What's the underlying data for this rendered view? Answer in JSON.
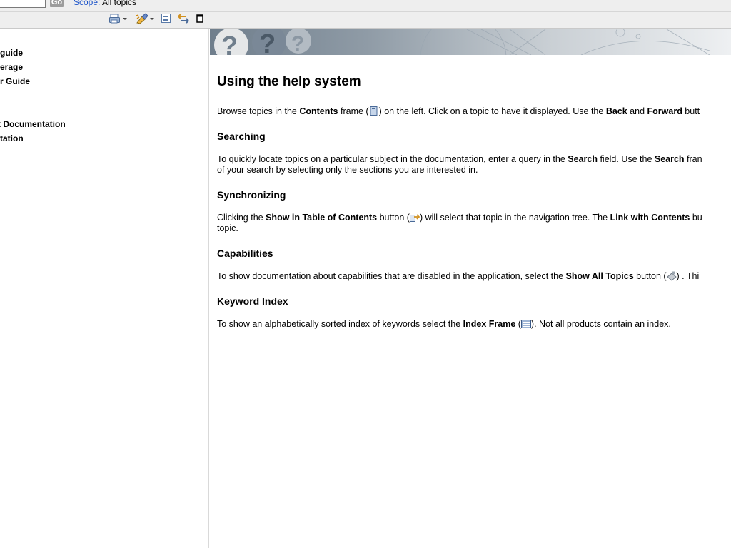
{
  "topbar": {
    "go_label": "Go",
    "scope_label": "Scope:",
    "scope_value": "All topics"
  },
  "toolbar": {
    "icons": [
      "print-icon",
      "highlight-icon",
      "collapse-all-icon",
      "sync-toc-icon",
      "maximize-icon"
    ]
  },
  "nav": {
    "items": [
      {
        "label": "guide"
      },
      {
        "label": "erage"
      },
      {
        "label": "r Guide"
      },
      {
        "label": "t Documentation"
      },
      {
        "label": "tation"
      }
    ]
  },
  "content": {
    "title": "Using the help system",
    "intro": {
      "t1": "Browse topics in the ",
      "b1": "Contents",
      "t2": " frame (",
      "t3": ") on the left. Click on a topic to have it displayed. Use the ",
      "b2": "Back",
      "t4": " and ",
      "b3": "Forward",
      "t5": " butt"
    },
    "searching": {
      "heading": "Searching",
      "t1": "To quickly locate topics on a particular subject in the documentation, enter a query in the ",
      "b1": "Search",
      "t2": " field. Use the ",
      "b2": "Search",
      "t3": " fran",
      "line2": "of your search by selecting only the sections you are interested in."
    },
    "synchronizing": {
      "heading": "Synchronizing",
      "t1": "Clicking the ",
      "b1": "Show in Table of Contents",
      "t2": " button (",
      "t3": ") will select that topic in the navigation tree. The ",
      "b2": "Link with Contents",
      "t4": " bu",
      "line2": "topic."
    },
    "capabilities": {
      "heading": "Capabilities",
      "t1": "To show documentation about capabilities that are disabled in the application, select the ",
      "b1": "Show All Topics",
      "t2": " button (",
      "t3": ") . Thi"
    },
    "keyword_index": {
      "heading": "Keyword Index",
      "t1": "To show an alphabetically sorted index of keywords select the ",
      "b1": "Index Frame",
      "t2": " (",
      "t3": "). Not all products contain an index."
    }
  },
  "colors": {
    "link": "#1a52c9",
    "go_button": "#9c9c9c",
    "chrome": "#eeeeee"
  }
}
